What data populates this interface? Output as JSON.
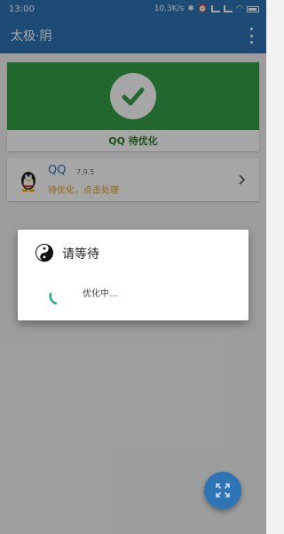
{
  "statusbar": {
    "time": "13:00",
    "network_speed": "10.3K/s",
    "icons": [
      "bluetooth-icon",
      "alarm-icon",
      "signal-icon",
      "signal-icon",
      "wifi-icon",
      "battery-icon"
    ]
  },
  "appbar": {
    "title": "太极·阴",
    "menu_icon": "more-vert-icon"
  },
  "status_card": {
    "icon": "check-icon",
    "status_text": "QQ 待优化",
    "banner_color": "#35a047"
  },
  "app_item": {
    "name": "QQ",
    "version": "7.9.5",
    "status": "待优化，点击处理",
    "icon": "qq-penguin-icon",
    "chevron_icon": "chevron-right-icon"
  },
  "dialog": {
    "icon": "taiji-icon",
    "title": "请等待",
    "message": "优化中..."
  },
  "fab": {
    "icon": "fullscreen-icon"
  },
  "colors": {
    "primary": "#2f74b5",
    "success": "#35a047",
    "warning": "#e0a020",
    "spinner": "#1aa39a"
  }
}
